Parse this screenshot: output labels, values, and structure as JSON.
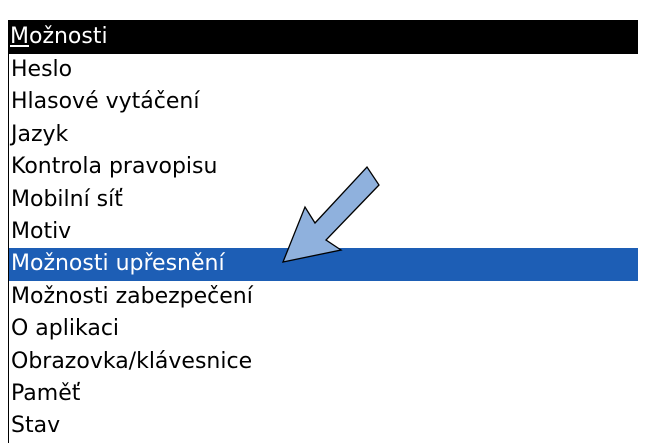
{
  "menu": {
    "title_accel": "M",
    "title_rest": "ožnosti",
    "items": [
      {
        "label": "Heslo",
        "selected": false
      },
      {
        "label": "Hlasové vytáčení",
        "selected": false
      },
      {
        "label": "Jazyk",
        "selected": false
      },
      {
        "label": "Kontrola pravopisu",
        "selected": false
      },
      {
        "label": "Mobilní síť",
        "selected": false
      },
      {
        "label": "Motiv",
        "selected": false
      },
      {
        "label": "Možnosti upřesnění",
        "selected": true
      },
      {
        "label": "Možnosti zabezpečení",
        "selected": false
      },
      {
        "label": "O aplikaci",
        "selected": false
      },
      {
        "label": "Obrazovka/klávesnice",
        "selected": false
      },
      {
        "label": "Paměť",
        "selected": false
      },
      {
        "label": "Stav",
        "selected": false
      }
    ]
  },
  "annotation": {
    "icon": "pointer-arrow-icon",
    "color": "#8fb1dd",
    "outline": "#000000"
  },
  "colors": {
    "title_bg": "#000000",
    "title_fg": "#ffffff",
    "selected_bg": "#1d5eb5",
    "selected_fg": "#ffffff"
  }
}
